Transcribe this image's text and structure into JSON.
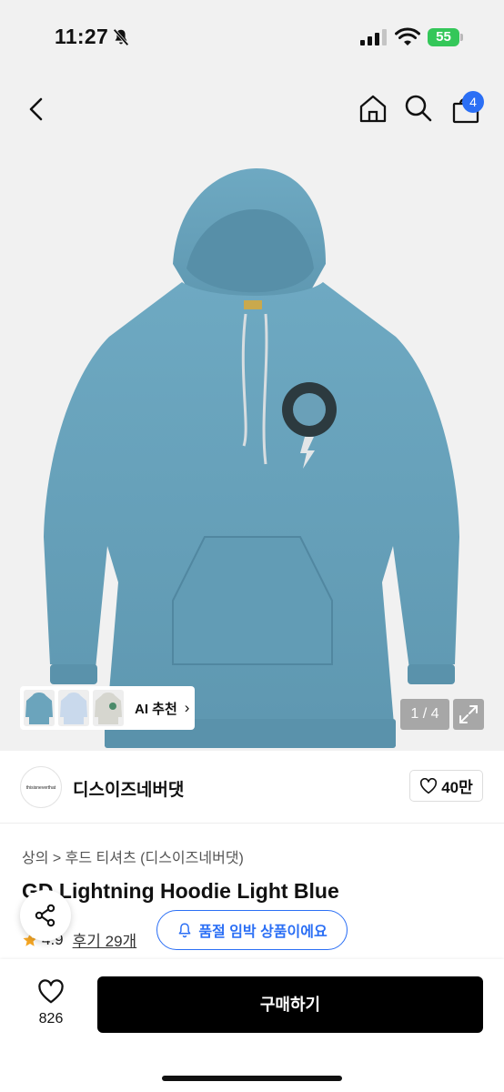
{
  "status_bar": {
    "time": "11:27",
    "battery": "55"
  },
  "nav": {
    "cart_count": "4"
  },
  "gallery": {
    "ai_recommend_label": "AI 추천",
    "page_counter": "1 / 4",
    "thumbnails": [
      "light-blue",
      "white-blue",
      "grey"
    ]
  },
  "brand": {
    "logo_text": "thisisneverthat",
    "name": "디스이즈네버댓",
    "follow_count": "40만"
  },
  "product": {
    "breadcrumb": "상의 > 후드 티셔츠 (디스이즈네버댓)",
    "title": "GD Lightning Hoodie Light Blue",
    "rating": "4.9",
    "review_link": "후기 29개",
    "stock_alert": "품절 임박 상품이에요"
  },
  "bottom_bar": {
    "like_count": "826",
    "buy_label": "구매하기"
  },
  "colors": {
    "accent": "#2b6ff5",
    "hoodie": "#6ba4bc",
    "star": "#f5a623"
  }
}
